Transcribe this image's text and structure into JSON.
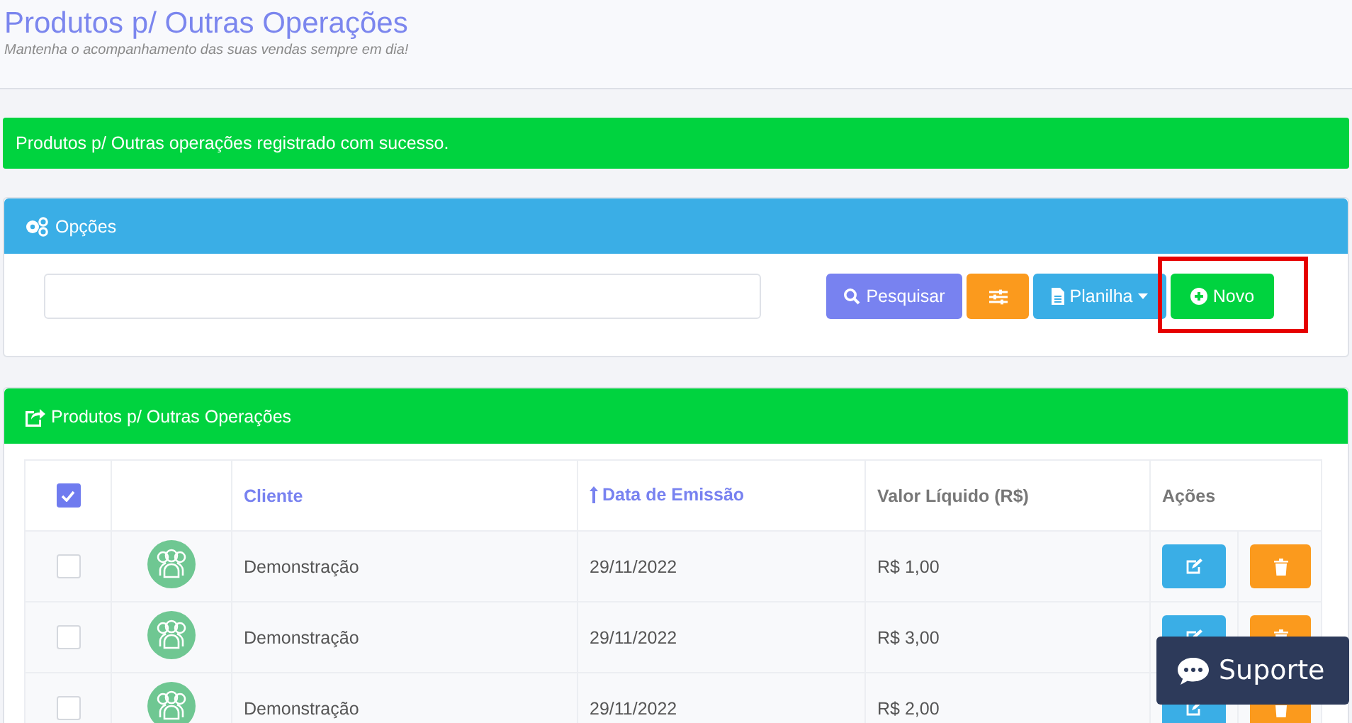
{
  "page": {
    "title": "Produtos p/ Outras Operações",
    "subtitle": "Mantenha o acompanhamento das suas vendas sempre em dia!"
  },
  "alert": {
    "message": "Produtos p/ Outras operações registrado com sucesso."
  },
  "options_panel": {
    "title": "Opções",
    "buttons": [
      {
        "kind": "search",
        "label": "Pesquisar",
        "highlighted": false
      },
      {
        "kind": "filter",
        "highlighted": false
      },
      {
        "kind": "spreadsheet",
        "label": "Planilha",
        "highlighted": false
      },
      {
        "kind": "new",
        "label": "Novo",
        "highlighted": true
      }
    ]
  },
  "list_panel": {
    "title": "Produtos p/ Outras Operações",
    "table": {
      "select_all": {
        "checked": true
      },
      "columns": [
        {
          "label": "Cliente",
          "sortable": true,
          "sorted": false
        },
        {
          "label": "Data de Emissão",
          "sortable": true,
          "sorted": true
        },
        {
          "label": "Valor Líquido (R$)",
          "sortable": false,
          "sorted": false
        },
        {
          "label": "Ações",
          "sortable": false,
          "sorted": false
        }
      ],
      "rows": [
        {
          "checked": false,
          "cliente": "Demonstração",
          "data": "29/11/2022",
          "valor": "R$ 1,00"
        },
        {
          "checked": false,
          "cliente": "Demonstração",
          "data": "29/11/2022",
          "valor": "R$ 3,00"
        },
        {
          "checked": false,
          "cliente": "Demonstração",
          "data": "29/11/2022",
          "valor": "R$ 2,00"
        }
      ]
    }
  },
  "support_button": {
    "label": "Suporte"
  }
}
